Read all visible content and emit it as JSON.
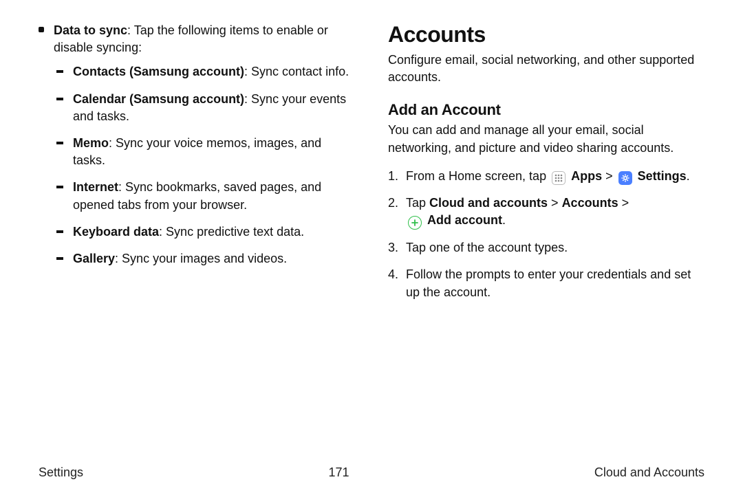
{
  "left": {
    "intro_bold": "Data to sync",
    "intro_rest": ": Tap the following items to enable or disable syncing:",
    "items": [
      {
        "bold": "Contacts (Samsung account)",
        "rest": ": Sync contact info."
      },
      {
        "bold": "Calendar (Samsung account)",
        "rest": ": Sync your events and tasks."
      },
      {
        "bold": "Memo",
        "rest": ": Sync your voice memos, images, and tasks."
      },
      {
        "bold": "Internet",
        "rest": ": Sync bookmarks, saved pages, and opened tabs from your browser."
      },
      {
        "bold": "Keyboard data",
        "rest": ": Sync predictive text data."
      },
      {
        "bold": "Gallery",
        "rest": ": Sync your images and videos."
      }
    ]
  },
  "right": {
    "h1": "Accounts",
    "sub": "Configure email, social networking, and other supported accounts.",
    "h2": "Add an Account",
    "h2sub": "You can add and manage all your email, social networking, and picture and video sharing accounts.",
    "step1_a": "From a Home screen, tap ",
    "step1_apps": "Apps",
    "step1_sep": " > ",
    "step1_settings": "Settings",
    "step1_end": ".",
    "step2_a": "Tap ",
    "step2_b": "Cloud and accounts",
    "step2_c": " > ",
    "step2_d": "Accounts",
    "step2_e": " > ",
    "step2_add": "Add account",
    "step2_end": ".",
    "step3": "Tap one of the account types.",
    "step4": "Follow the prompts to enter your credentials and set up the account."
  },
  "footer": {
    "left": "Settings",
    "center": "171",
    "right": "Cloud and Accounts"
  }
}
